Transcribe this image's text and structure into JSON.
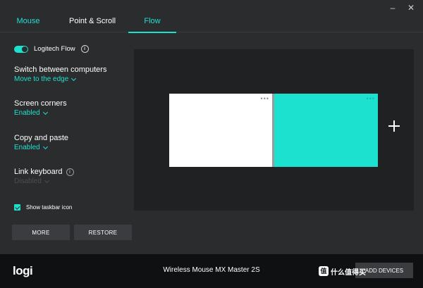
{
  "window": {
    "controls": {
      "minimize": "–",
      "close": "✕"
    }
  },
  "tabs": [
    {
      "label": "Mouse"
    },
    {
      "label": "Point & Scroll"
    },
    {
      "label": "Flow"
    }
  ],
  "settings": {
    "logitech_flow": {
      "label": "Logitech Flow",
      "enabled": true,
      "info_icon": "i"
    },
    "switch_between": {
      "title": "Switch between computers",
      "value": "Move to the edge"
    },
    "screen_corners": {
      "title": "Screen corners",
      "value": "Enabled"
    },
    "copy_paste": {
      "title": "Copy and paste",
      "value": "Enabled"
    },
    "link_keyboard": {
      "title": "Link keyboard",
      "value": "Disabled",
      "info_icon": "i"
    },
    "show_taskbar": {
      "label": "Show taskbar icon",
      "checked": true
    }
  },
  "buttons": {
    "more": "MORE",
    "restore": "RESTORE"
  },
  "flow_panel": {
    "screen1_menu": "•••",
    "screen2_menu": "•••",
    "accent_color": "#1de1cf"
  },
  "footer": {
    "logo": "logi",
    "device_name": "Wireless Mouse MX Master 2S",
    "add_device": "ADD DEVICES",
    "watermark": "什么值得买",
    "watermark_badge": "值"
  }
}
